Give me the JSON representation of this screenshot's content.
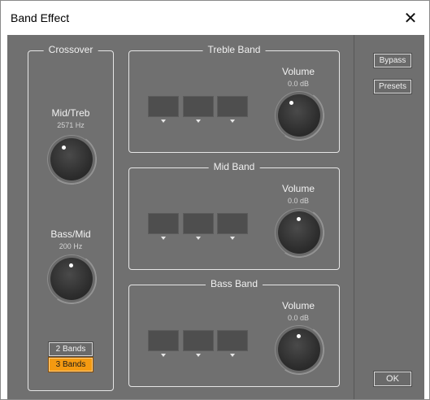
{
  "window": {
    "title": "Band Effect",
    "close_glyph": "✕"
  },
  "crossover": {
    "label": "Crossover",
    "mid_treb": {
      "label": "Mid/Treb",
      "value": "2571 Hz"
    },
    "bass_mid": {
      "label": "Bass/Mid",
      "value": "200 Hz"
    },
    "band_options": [
      "2 Bands",
      "3 Bands"
    ],
    "selected_bands": "3 Bands"
  },
  "bands": [
    {
      "label": "Treble Band",
      "volume_label": "Volume",
      "volume_value": "0.0 dB"
    },
    {
      "label": "Mid Band",
      "volume_label": "Volume",
      "volume_value": "0.0 dB"
    },
    {
      "label": "Bass Band",
      "volume_label": "Volume",
      "volume_value": "0.0 dB"
    }
  ],
  "sidebar": {
    "bypass": "Bypass",
    "presets": "Presets",
    "ok": "OK"
  },
  "colors": {
    "panel": "#707070",
    "accent": "#f49a11"
  },
  "icons": {
    "close": "close-icon",
    "dropdown": "caret-down-icon"
  }
}
